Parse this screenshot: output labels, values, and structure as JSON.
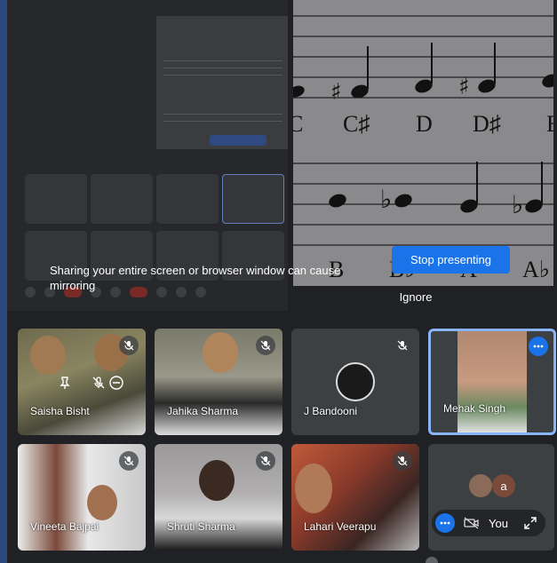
{
  "presentation": {
    "warning_text": "Sharing your entire screen or browser window can cause mirroring",
    "stop_button": "Stop presenting",
    "ignore_button": "Ignore",
    "notes": [
      "C",
      "C♯",
      "D",
      "D♯",
      "E"
    ],
    "notes_row2": [
      "B",
      "B♭",
      "A",
      "A♭"
    ]
  },
  "participants": [
    {
      "name": "Saisha Bisht",
      "mic_muted": true
    },
    {
      "name": "Jahika Sharma",
      "mic_muted": true
    },
    {
      "name": "J Bandooni",
      "mic_muted": true
    },
    {
      "name": "Mehak Singh",
      "mic_muted": false,
      "active": true
    },
    {
      "name": "Vineeta Bajpai",
      "mic_muted": true
    },
    {
      "name": "Shruti Sharma",
      "mic_muted": true
    },
    {
      "name": "Lahari Veerapu",
      "mic_muted": true
    }
  ],
  "self_tile": {
    "label": "You",
    "avatar_letter": "a"
  },
  "colors": {
    "accent": "#1a73e8",
    "active_border": "#8ab4f8",
    "background": "#202124"
  }
}
